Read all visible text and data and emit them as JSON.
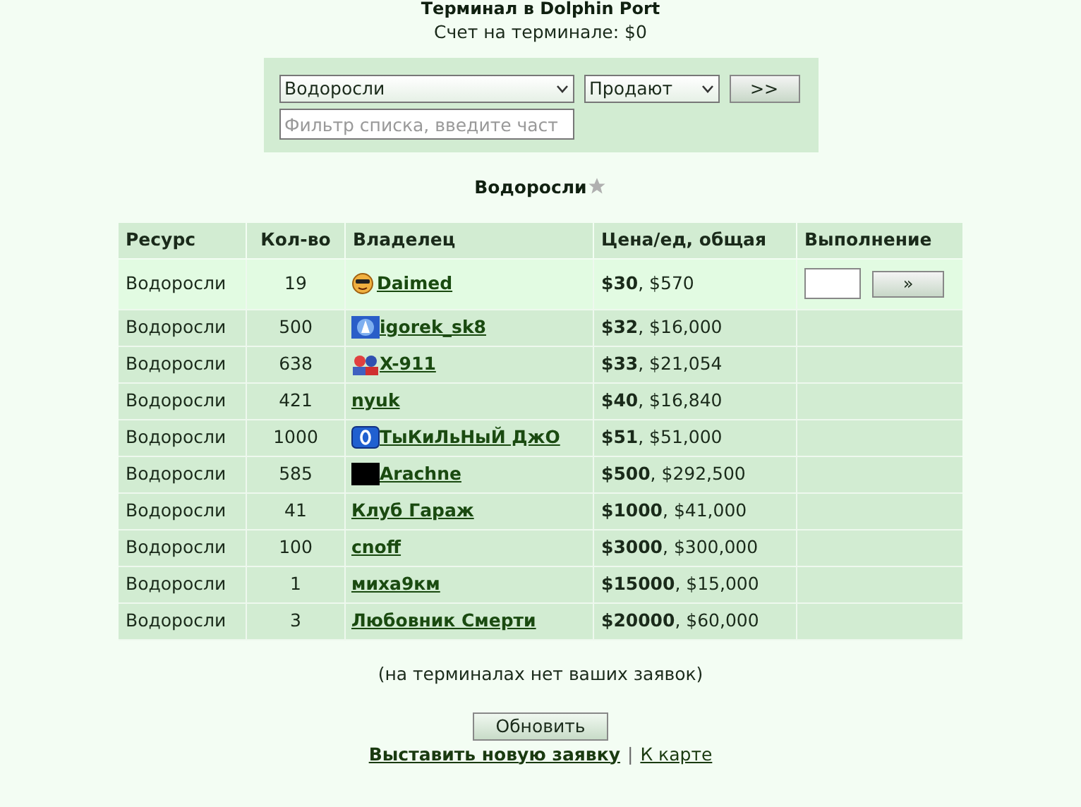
{
  "header": {
    "title": "Терминал в Dolphin Port",
    "account": "Счет на терминале: $0"
  },
  "filter": {
    "resource": "Водоросли",
    "mode": "Продают",
    "go": ">>",
    "placeholder": "Фильтр списка, введите част"
  },
  "heading": {
    "title": "Водоросли",
    "favorite": false
  },
  "table": {
    "columns": [
      "Ресурс",
      "Кол-во",
      "Владелец",
      "Цена/ед, общая",
      "Выполнение"
    ],
    "rows": [
      {
        "resource": "Водоросли",
        "qty": "19",
        "kind": "smiley",
        "owner": "Daimed",
        "price": "$30",
        "total": ", $570",
        "highlighted": true,
        "action": "»"
      },
      {
        "resource": "Водоросли",
        "qty": "500",
        "kind": "badge",
        "owner": "igorek_sk8",
        "price": "$32",
        "total": ", $16,000",
        "highlighted": false
      },
      {
        "resource": "Водоросли",
        "qty": "638",
        "kind": "pair",
        "owner": "X-911",
        "price": "$33",
        "total": ", $21,054",
        "highlighted": false
      },
      {
        "resource": "Водоросли",
        "qty": "421",
        "owner": "nyuk",
        "price": "$40",
        "total": ", $16,840",
        "highlighted": false
      },
      {
        "resource": "Водоросли",
        "qty": "1000",
        "kind": "zero",
        "owner": "ТыКиЛьНыЙ ДжО",
        "price": "$51",
        "total": ", $51,000",
        "highlighted": false
      },
      {
        "resource": "Водоросли",
        "qty": "585",
        "kind": "block",
        "owner": "Arachne",
        "price": "$500",
        "total": ", $292,500",
        "highlighted": false
      },
      {
        "resource": "Водоросли",
        "qty": "41",
        "owner": "Клуб Гараж",
        "price": "$1000",
        "total": ", $41,000",
        "highlighted": false
      },
      {
        "resource": "Водоросли",
        "qty": "100",
        "owner": "cnoff",
        "price": "$3000",
        "total": ", $300,000",
        "highlighted": false
      },
      {
        "resource": "Водоросли",
        "qty": "1",
        "owner": "миха9км",
        "price": "$15000",
        "total": ", $15,000",
        "highlighted": false
      },
      {
        "resource": "Водоросли",
        "qty": "3",
        "owner": "Любовник Смерти",
        "price": "$20000",
        "total": ", $60,000",
        "highlighted": false
      }
    ]
  },
  "note": "(на терминалах нет ваших заявок)",
  "refresh": "Обновить",
  "links": [
    {
      "label": "Выставить новую заявку",
      "bold": true
    },
    {
      "label": "К карте",
      "bold": false
    }
  ],
  "separator": "|"
}
